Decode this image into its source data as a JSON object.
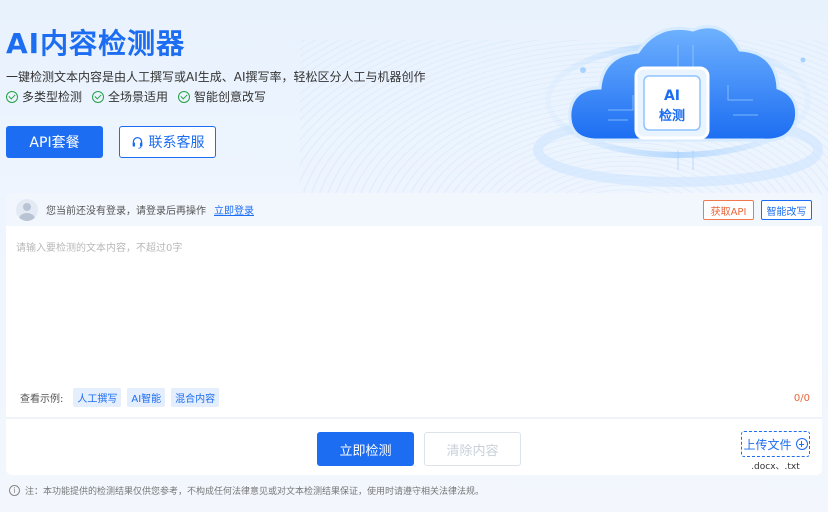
{
  "hero": {
    "title": "AI内容检测器",
    "subtitle": "一键检测文本内容是由人工撰写或AI生成、AI撰写率，轻松区分人工与机器创作",
    "features": [
      "多类型检测",
      "全场景适用",
      "智能创意改写"
    ],
    "api_button": "API套餐",
    "support_button": "联系客服",
    "art_label_line1": "AI",
    "art_label_line2": "检测"
  },
  "login_bar": {
    "message": "您当前还没有登录，请登录后再操作",
    "login_link": "立即登录",
    "get_api_button": "获取API",
    "rewrite_button": "智能改写"
  },
  "editor": {
    "placeholder": "请输入要检测的文本内容，不超过0字",
    "examples_label": "查看示例:",
    "examples": [
      "人工撰写",
      "AI智能",
      "混合内容"
    ],
    "counter": "0/0"
  },
  "actions": {
    "detect_button": "立即检测",
    "clear_button": "清除内容",
    "upload_button": "上传文件",
    "upload_formats": ".docx、.txt"
  },
  "note": {
    "icon_glyph": "i",
    "text": "注：本功能提供的检测结果仅供您参考，不构成任何法律意见或对文本检测结果保证，使用时请遵守相关法律法规。"
  },
  "colors": {
    "primary": "#1c6df2",
    "warning": "#e8663a",
    "success": "#26a047"
  }
}
